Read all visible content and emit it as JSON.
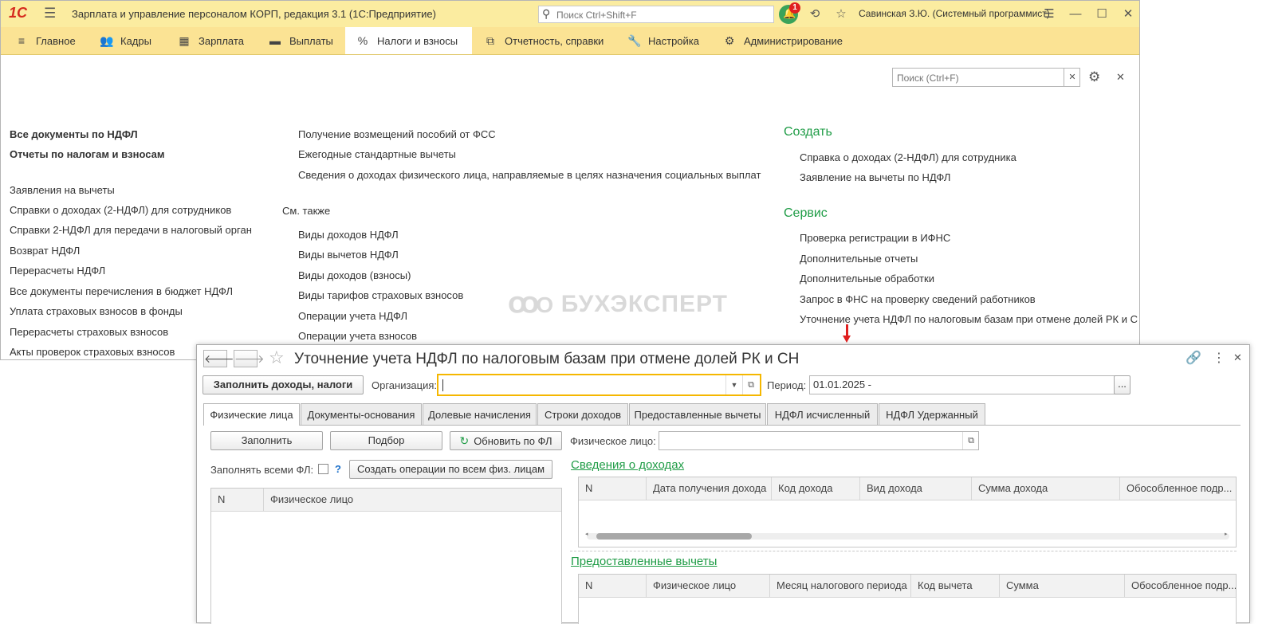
{
  "app": {
    "logo": "1С",
    "title": "Зарплата и управление персоналом КОРП, редакция 3.1  (1С:Предприятие)",
    "search_placeholder": "Поиск Ctrl+Shift+F",
    "notification_count": "1",
    "user": "Савинская З.Ю. (Системный программист)"
  },
  "nav": {
    "items": [
      {
        "label": "Главное",
        "icon": "menu-icon"
      },
      {
        "label": "Кадры",
        "icon": "people-icon"
      },
      {
        "label": "Зарплата",
        "icon": "calculator-icon"
      },
      {
        "label": "Выплаты",
        "icon": "wallet-icon"
      },
      {
        "label": "Налоги и взносы",
        "icon": "percent-icon"
      },
      {
        "label": "Отчетность, справки",
        "icon": "copy-icon"
      },
      {
        "label": "Настройка",
        "icon": "wrench-icon"
      },
      {
        "label": "Администрирование",
        "icon": "gear-icon"
      }
    ]
  },
  "section": {
    "search_placeholder": "Поиск (Ctrl+F)",
    "col1": {
      "bold_links": [
        "Все документы по НДФЛ",
        "Отчеты по налогам и взносам"
      ],
      "links": [
        "Заявления на вычеты",
        "Справки о доходах (2-НДФЛ) для сотрудников",
        "Справки 2-НДФЛ для передачи в налоговый орган",
        "Возврат НДФЛ",
        "Перерасчеты НДФЛ",
        "Все документы перечисления в бюджет НДФЛ",
        "Уплата страховых взносов в фонды",
        "Перерасчеты страховых взносов",
        "Акты проверок страховых взносов"
      ]
    },
    "col2": {
      "links": [
        "Получение возмещений пособий от ФСС",
        "Ежегодные стандартные вычеты",
        "Сведения о доходах физического лица, направляемые в целях назначения социальных выплат"
      ],
      "see_also": "См. также",
      "see_also_links": [
        "Виды доходов НДФЛ",
        "Виды вычетов НДФЛ",
        "Виды доходов (взносы)",
        "Виды тарифов страховых взносов",
        "Операции учета НДФЛ",
        "Операции учета взносов"
      ]
    },
    "col3": {
      "create_header": "Создать",
      "create_links": [
        "Справка о доходах (2-НДФЛ) для сотрудника",
        "Заявление на вычеты по НДФЛ"
      ],
      "service_header": "Сервис",
      "service_links": [
        "Проверка регистрации в ИФНС",
        "Дополнительные отчеты",
        "Дополнительные обработки",
        "Запрос в ФНС на проверку сведений работников",
        "Уточнение учета НДФЛ по налоговым базам при отмене долей РК и СН"
      ]
    },
    "watermark": "БУХЭКСПЕРТ"
  },
  "form": {
    "title": "Уточнение учета НДФЛ по налоговым базам при отмене долей РК и СН",
    "fill_button": "Заполнить доходы, налоги",
    "org_label": "Организация:",
    "org_value": "",
    "period_label": "Период:",
    "period_value": "01.01.2025 -",
    "period_btn": "...",
    "tabs": [
      "Физические лица",
      "Документы-основания",
      "Долевые начисления",
      "Строки доходов",
      "Предоставленные вычеты",
      "НДФЛ исчисленный",
      "НДФЛ Удержанный"
    ],
    "btn_fill": "Заполнить",
    "btn_select": "Подбор",
    "btn_refresh": "Обновить по ФЛ",
    "fill_all_label": "Заполнять всеми ФЛ:",
    "help": "?",
    "btn_create_ops": "Создать операции по всем физ. лицам",
    "left_grid_cols": [
      "N",
      "Физическое лицо"
    ],
    "person_label": "Физическое лицо:",
    "income_header": "Сведения о доходах",
    "income_cols": [
      "N",
      "Дата получения дохода",
      "Код дохода",
      "Вид дохода",
      "Сумма дохода",
      "Обособленное подр..."
    ],
    "deduct_header": "Предоставленные вычеты",
    "deduct_cols": [
      "N",
      "Физическое лицо",
      "Месяц налогового периода",
      "Код вычета",
      "Сумма",
      "Обособленное подр..."
    ]
  },
  "colors": {
    "accent_yellow": "#fbe394",
    "link_green": "#1f9c46",
    "arrow_red": "#e02020",
    "focus_orange": "#f5b700"
  }
}
